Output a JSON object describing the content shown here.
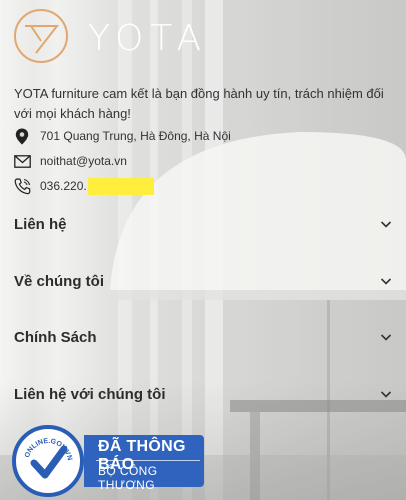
{
  "brand": {
    "name": "YOTA",
    "logo_icon": "yota-monogram-icon",
    "accent": "#e0a86f"
  },
  "tagline": "YOTA furniture cam kết là bạn đồng hành uy tín, trách nhiệm đối với mọi khách hàng!",
  "contacts": {
    "address": {
      "icon": "location-pin-icon",
      "text": "701 Quang Trung, Hà Đông, Hà Nội"
    },
    "email": {
      "icon": "mail-icon",
      "text": "noithat@yota.vn"
    },
    "phone": {
      "icon": "phone-icon",
      "text": "036.220."
    }
  },
  "sections": [
    {
      "label": "Liên hệ"
    },
    {
      "label": "Về chúng tôi"
    },
    {
      "label": "Chính Sách"
    },
    {
      "label": "Liên hệ với chúng tôi"
    }
  ],
  "badge": {
    "line1": "ĐÃ THÔNG BÁO",
    "line2": "BỘ CÔNG THƯƠNG",
    "seal_text": "ONLINE.GOV.VN",
    "color": "#2f63bd"
  }
}
